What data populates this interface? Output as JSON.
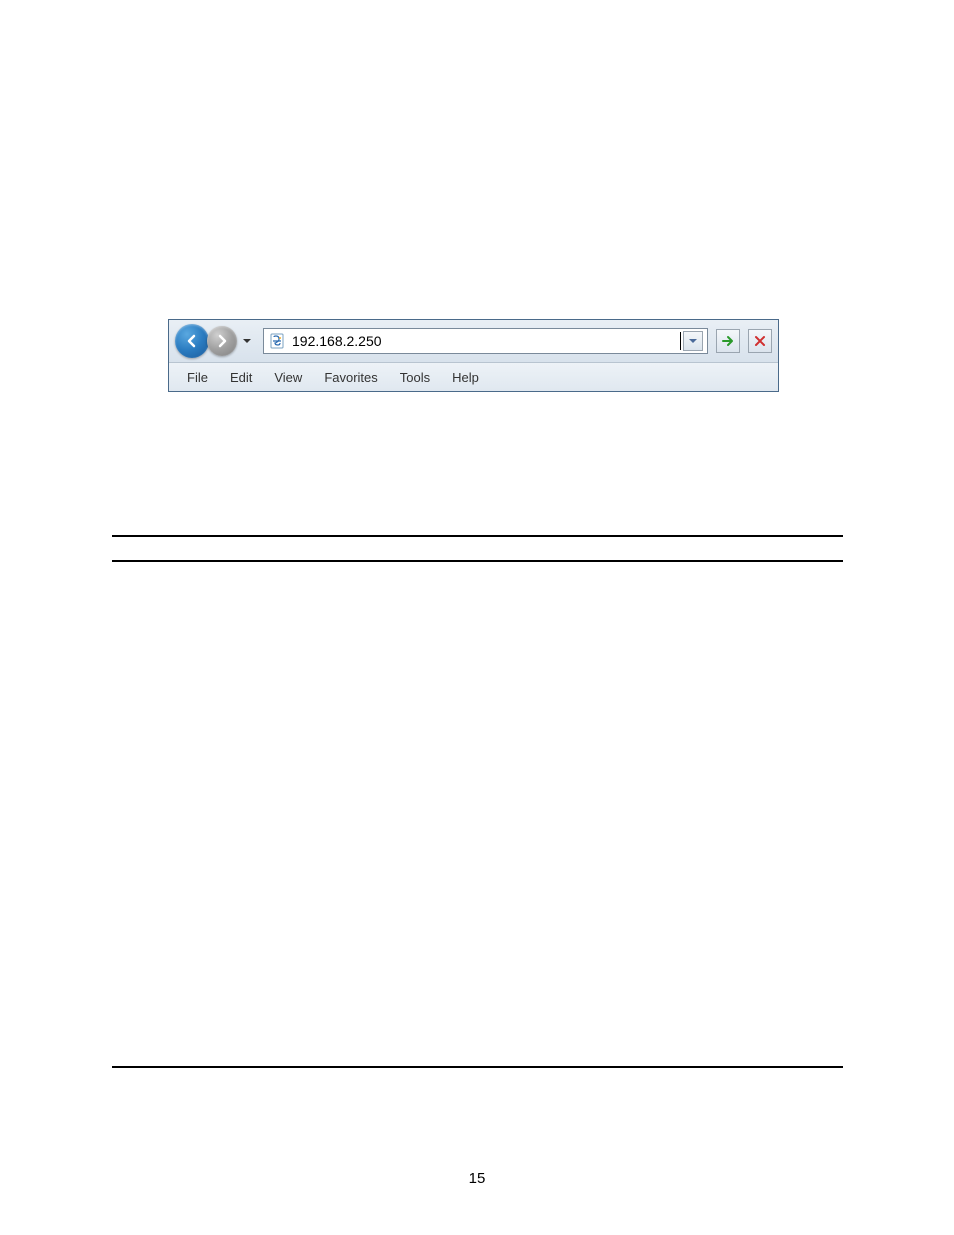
{
  "address_bar": {
    "value": "192.168.2.250"
  },
  "menu": {
    "items": [
      "File",
      "Edit",
      "View",
      "Favorites",
      "Tools",
      "Help"
    ]
  },
  "page_number": "15"
}
